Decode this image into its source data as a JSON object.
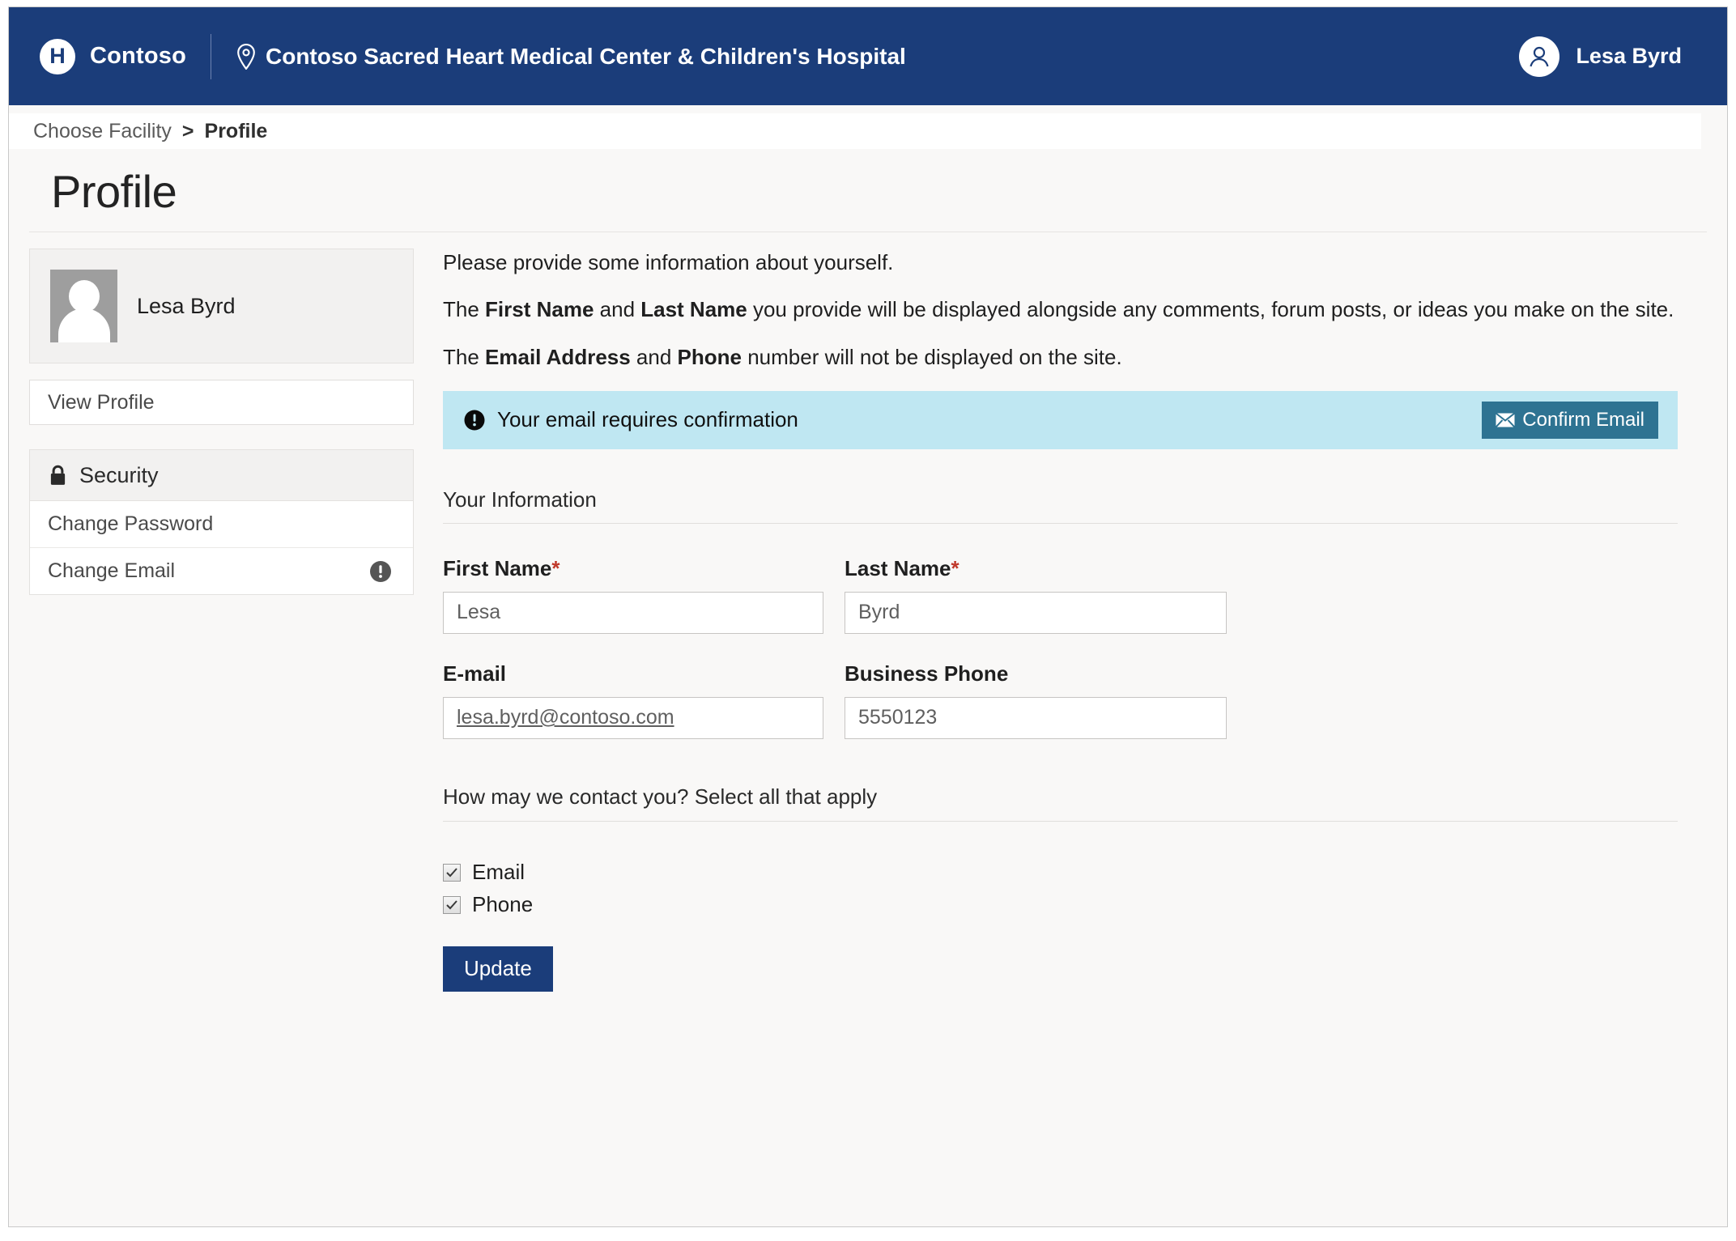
{
  "topbar": {
    "logo_icon": "hospital-h-icon",
    "brand": "Contoso",
    "pin_icon": "location-pin-icon",
    "facility": "Contoso Sacred Heart Medical Center & Children's Hospital",
    "user_avatar_icon": "user-avatar-icon",
    "user_name": "Lesa Byrd"
  },
  "breadcrumb": {
    "parent": "Choose Facility",
    "separator": ">",
    "current": "Profile"
  },
  "page": {
    "title": "Profile"
  },
  "sidebar": {
    "profile_card": {
      "avatar_icon": "person-placeholder-icon",
      "name": "Lesa Byrd"
    },
    "view_profile_label": "View Profile",
    "security": {
      "lock_icon": "lock-icon",
      "header": "Security",
      "items": [
        {
          "label": "Change Password",
          "badge": ""
        },
        {
          "label": "Change Email",
          "badge": "alert-circle-icon"
        }
      ]
    }
  },
  "main": {
    "intro": {
      "line1": "Please provide some information about yourself.",
      "line2_a": "The ",
      "line2_b1": "First Name",
      "line2_c": " and ",
      "line2_b2": "Last Name",
      "line2_d": " you provide will be displayed alongside any comments, forum posts, or ideas you make on the site.",
      "line3_a": "The ",
      "line3_b1": "Email Address",
      "line3_c": " and ",
      "line3_b2": "Phone",
      "line3_d": " number will not be displayed on the site."
    },
    "alert": {
      "icon": "exclamation-circle-icon",
      "text": "Your email requires confirmation",
      "button_icon": "envelope-icon",
      "button_label": "Confirm Email"
    },
    "your_information_header": "Your Information",
    "fields": {
      "first_name_label": "First Name",
      "first_name_required": "*",
      "first_name_value": "Lesa",
      "last_name_label": "Last Name",
      "last_name_required": "*",
      "last_name_value": "Byrd",
      "email_label": "E-mail",
      "email_value": "lesa.byrd@contoso.com",
      "phone_label": "Business Phone",
      "phone_value": "5550123"
    },
    "contact_header": "How may we contact you? Select all that apply",
    "checkboxes": [
      {
        "label": "Email",
        "checked": true
      },
      {
        "label": "Phone",
        "checked": true
      }
    ],
    "update_label": "Update"
  },
  "colors": {
    "brand_navy": "#1b3d7a",
    "alert_bg": "#bfe7f2",
    "confirm_btn": "#2e7392",
    "required_red": "#c0392b",
    "page_bg": "#f9f8f7"
  }
}
